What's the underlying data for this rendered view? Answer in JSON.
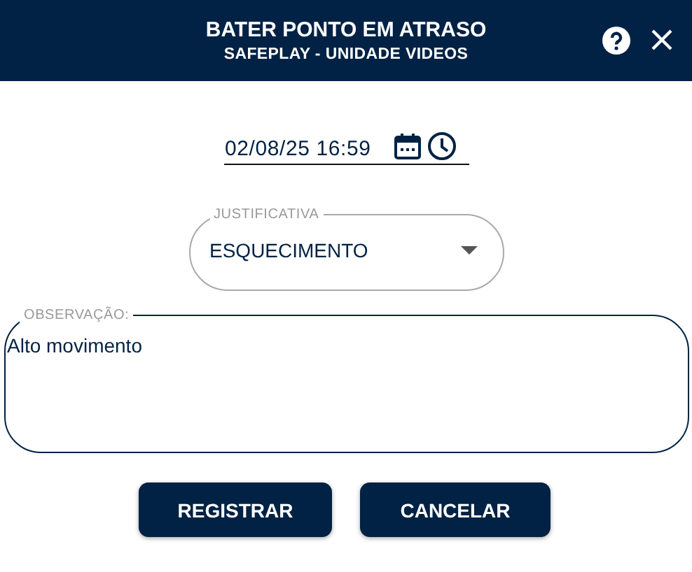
{
  "header": {
    "title": "BATER PONTO EM ATRASO",
    "subtitle": "SAFEPLAY - UNIDADE VIDEOS"
  },
  "datetime": {
    "value": "02/08/25 16:59"
  },
  "justificativa": {
    "label": "JUSTIFICATIVA",
    "value": "ESQUECIMENTO"
  },
  "observacao": {
    "label": "OBSERVAÇÃO:",
    "value": "Alto movimento"
  },
  "buttons": [
    "REGISTRAR",
    "CANCELAR"
  ]
}
